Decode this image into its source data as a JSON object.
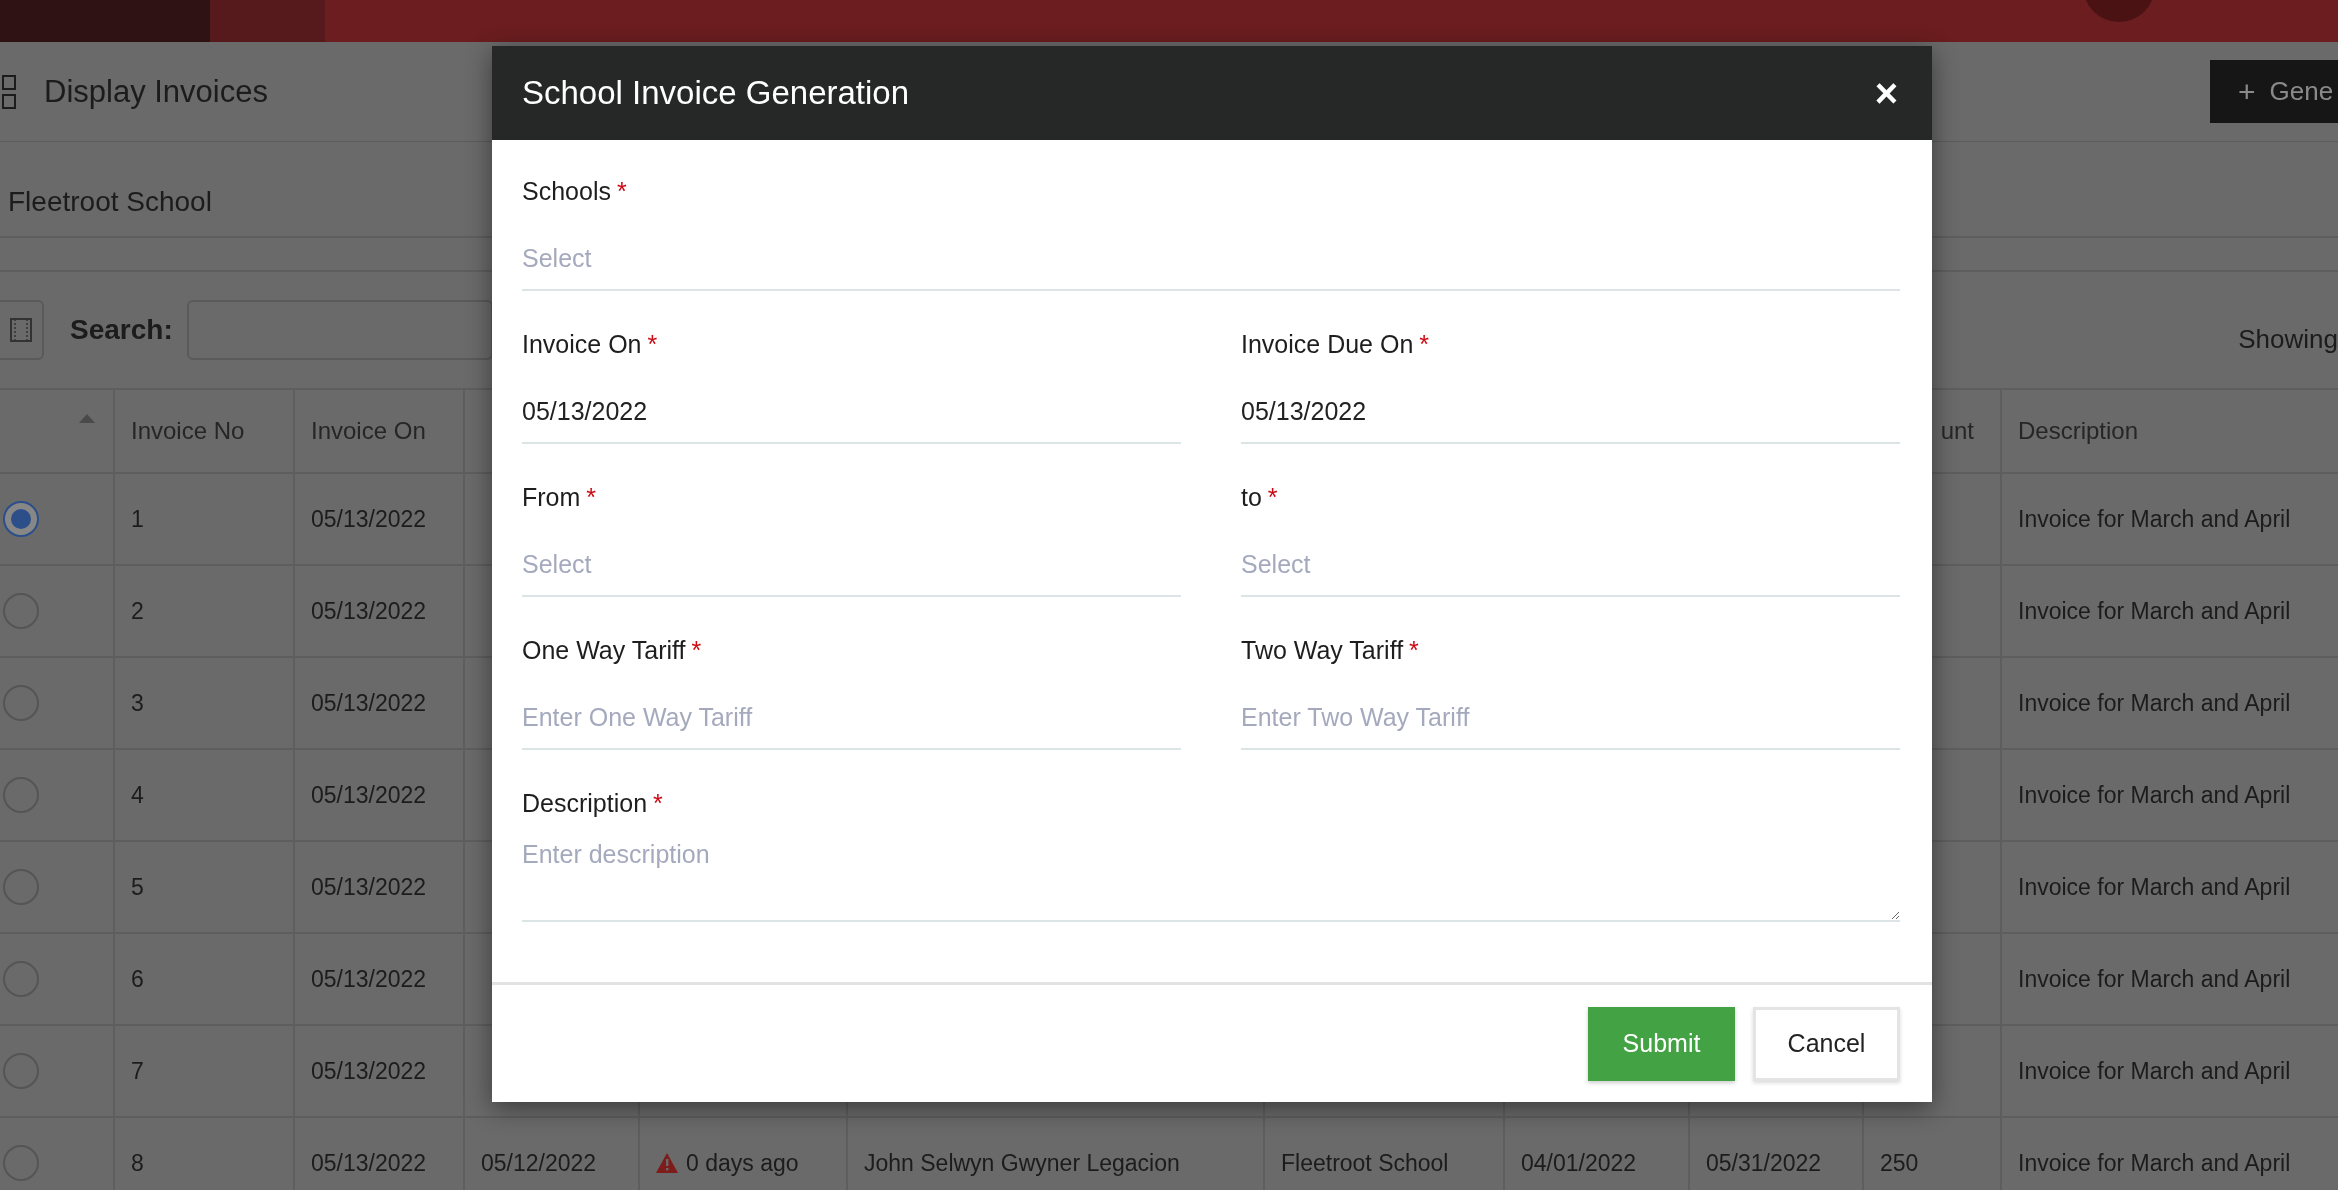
{
  "page": {
    "title": "Display Invoices",
    "generate_button": {
      "icon": "+",
      "label": "Gene"
    },
    "school": "Fleetroot School",
    "search_label": "Search:",
    "showing": "Showing"
  },
  "table": {
    "header": {
      "invoice_no": "Invoice No",
      "invoice_on": "Invoice On",
      "column_10": "unt",
      "description": "Description"
    },
    "rows": [
      {
        "selected": true,
        "invoice_no": "1",
        "invoice_on": "05/13/2022",
        "description": "Invoice for March and April"
      },
      {
        "selected": false,
        "invoice_no": "2",
        "invoice_on": "05/13/2022",
        "description": "Invoice for March and April"
      },
      {
        "selected": false,
        "invoice_no": "3",
        "invoice_on": "05/13/2022",
        "description": "Invoice for March and April"
      },
      {
        "selected": false,
        "invoice_no": "4",
        "invoice_on": "05/13/2022",
        "description": "Invoice for March and April"
      },
      {
        "selected": false,
        "invoice_no": "5",
        "invoice_on": "05/13/2022",
        "description": "Invoice for March and April"
      },
      {
        "selected": false,
        "invoice_no": "6",
        "invoice_on": "05/13/2022",
        "description": "Invoice for March and April"
      },
      {
        "selected": false,
        "invoice_no": "7",
        "invoice_on": "05/13/2022",
        "description": "Invoice for March and April"
      },
      {
        "selected": false,
        "invoice_no": "8",
        "invoice_on": "05/13/2022",
        "column_4": "05/12/2022",
        "column_5": "0 days ago",
        "column_6": "John Selwyn Gwyner Legacion",
        "column_7": "Fleetroot School",
        "column_8": "04/01/2022",
        "column_9": "05/31/2022",
        "column_10": "250",
        "description": "Invoice for March and April"
      }
    ]
  },
  "modal": {
    "title": "School Invoice Generation",
    "close": "×",
    "rows": [
      [
        {
          "kind": "input",
          "label": "Schools",
          "required_mark": "*",
          "placeholder": "Select"
        }
      ],
      [
        {
          "kind": "input",
          "label": "Invoice On",
          "required_mark": "*",
          "value": "05/13/2022"
        },
        {
          "kind": "input",
          "label": "Invoice Due On",
          "required_mark": "*",
          "value": "05/13/2022"
        }
      ],
      [
        {
          "kind": "input",
          "label": "From",
          "required_mark": "*",
          "placeholder": "Select"
        },
        {
          "kind": "input",
          "label": "to",
          "required_mark": "*",
          "placeholder": "Select"
        }
      ],
      [
        {
          "kind": "input",
          "label": "One Way Tariff",
          "required_mark": "*",
          "placeholder": "Enter One Way Tariff"
        },
        {
          "kind": "input",
          "label": "Two Way Tariff",
          "required_mark": "*",
          "placeholder": "Enter Two Way Tariff"
        }
      ],
      [
        {
          "kind": "textarea",
          "label": "Description",
          "required_mark": "*",
          "placeholder": "Enter description"
        }
      ]
    ],
    "buttons": [
      {
        "kind": "primary",
        "label": "Submit"
      },
      {
        "kind": "default",
        "label": "Cancel"
      }
    ]
  }
}
